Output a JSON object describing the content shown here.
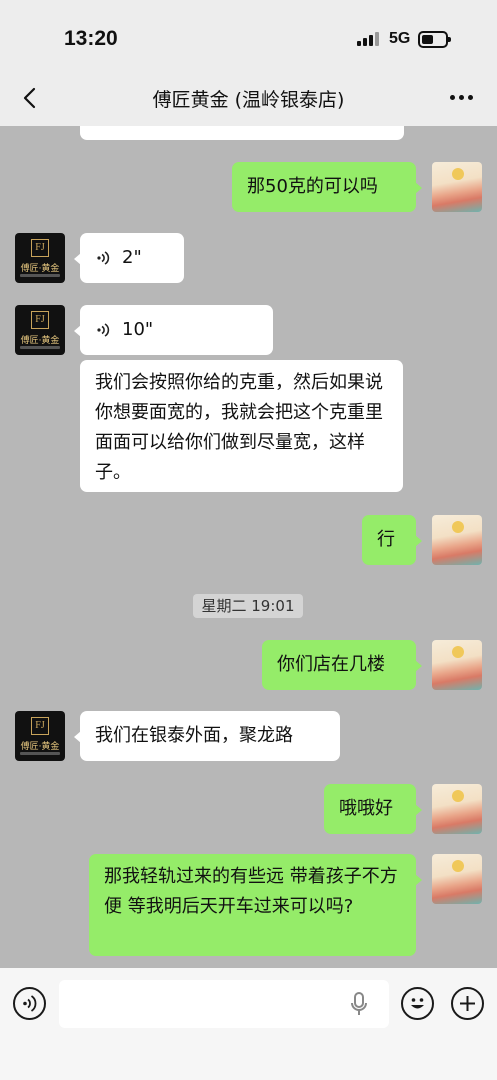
{
  "status": {
    "time": "13:20",
    "network": "5G"
  },
  "header": {
    "title": "傅匠黄金 (温岭银泰店)"
  },
  "avatars": {
    "shop_brand": "傅匠·黄金",
    "shop_logo": "FJ"
  },
  "messages": {
    "m1": "那50克的可以吗",
    "m2": "2\"",
    "m3": "10\"",
    "m4": "我们会按照你给的克重，然后如果说你想要面宽的，我就会把这个克重里面面可以给你们做到尽量宽，这样子。",
    "m5": "行",
    "m6": "你们店在几楼",
    "m7": "我们在银泰外面，聚龙路",
    "m8": "哦哦好",
    "m9": "那我轻轨过来的有些远 带着孩子不方便 等我明后天开车过来可以吗?"
  },
  "timestamp": "星期二 19:01",
  "input": {
    "value": ""
  },
  "colors": {
    "sent_bubble": "#95ec69",
    "received_bubble": "#ffffff",
    "chat_bg": "#b7b7b7"
  }
}
